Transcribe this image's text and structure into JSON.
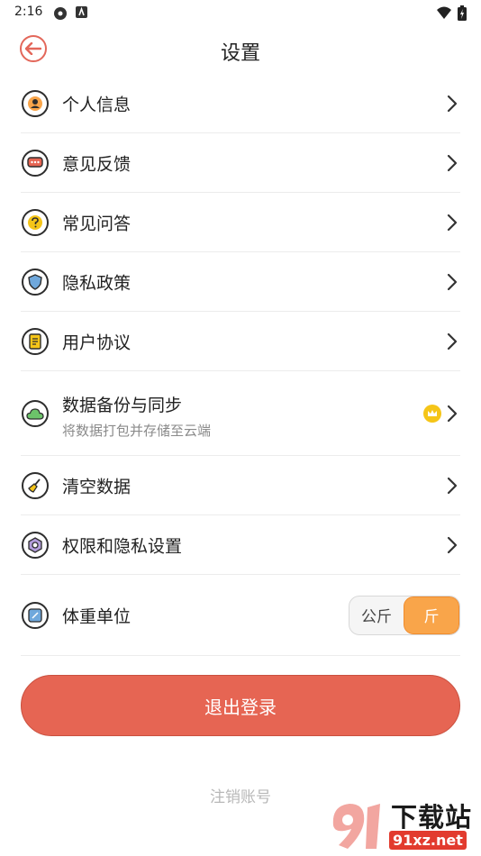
{
  "status": {
    "time": "2:16"
  },
  "header": {
    "title": "设置"
  },
  "menu": [
    {
      "label": "个人信息",
      "icon": "user-icon"
    },
    {
      "label": "意见反馈",
      "icon": "feedback-icon"
    },
    {
      "label": "常见问答",
      "icon": "question-icon"
    },
    {
      "label": "隐私政策",
      "icon": "shield-icon"
    },
    {
      "label": "用户协议",
      "icon": "document-icon"
    },
    {
      "label": "数据备份与同步",
      "sub": "将数据打包并存储至云端",
      "icon": "cloud-icon",
      "badge": "crown-icon"
    },
    {
      "label": "清空数据",
      "icon": "broom-icon"
    },
    {
      "label": "权限和隐私设置",
      "icon": "privacy-settings-icon"
    }
  ],
  "weight_unit": {
    "label": "体重单位",
    "options": [
      "公斤",
      "斤"
    ],
    "selected": "斤"
  },
  "logout_label": "退出登录",
  "deregister_label": "注销账号",
  "watermark": {
    "title": "下载站",
    "site": "91xz.net"
  },
  "colors": {
    "accent": "#e66553",
    "toggle_active": "#f9a54a",
    "badge": "#f5c518"
  }
}
